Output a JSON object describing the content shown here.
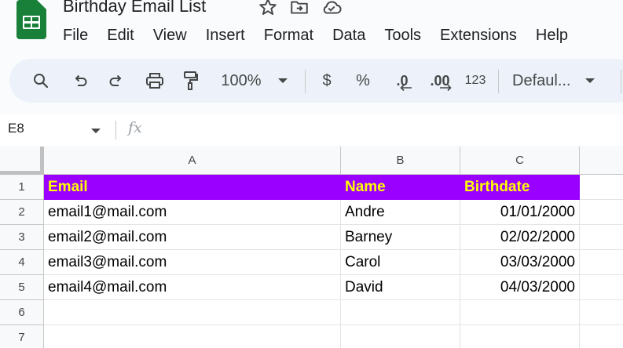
{
  "doc": {
    "title": "Birthday Email List"
  },
  "menu": [
    "File",
    "Edit",
    "View",
    "Insert",
    "Format",
    "Data",
    "Tools",
    "Extensions",
    "Help"
  ],
  "toolbar": {
    "zoom": "100%",
    "currency": "$",
    "percent": "%",
    "decrease_decimal": ".0",
    "increase_decimal": ".00",
    "number_format": "123",
    "font": "Defaul..."
  },
  "formula_bar": {
    "cell_ref": "E8",
    "fx": "fx",
    "value": ""
  },
  "columns": [
    "A",
    "B",
    "C"
  ],
  "rows": [
    "1",
    "2",
    "3",
    "4",
    "5",
    "6",
    "7"
  ],
  "sheet": {
    "header": {
      "a": "Email",
      "b": "Name",
      "c": "Birthdate"
    },
    "data": [
      {
        "a": "email1@mail.com",
        "b": "Andre",
        "c": "01/01/2000"
      },
      {
        "a": "email2@mail.com",
        "b": "Barney",
        "c": "02/02/2000"
      },
      {
        "a": "email3@mail.com",
        "b": "Carol",
        "c": "03/03/2000"
      },
      {
        "a": "email4@mail.com",
        "b": "David",
        "c": "04/03/2000"
      }
    ]
  },
  "colors": {
    "header_fill": "#9900ff",
    "header_text": "#ffff00",
    "logo": "#188038"
  }
}
